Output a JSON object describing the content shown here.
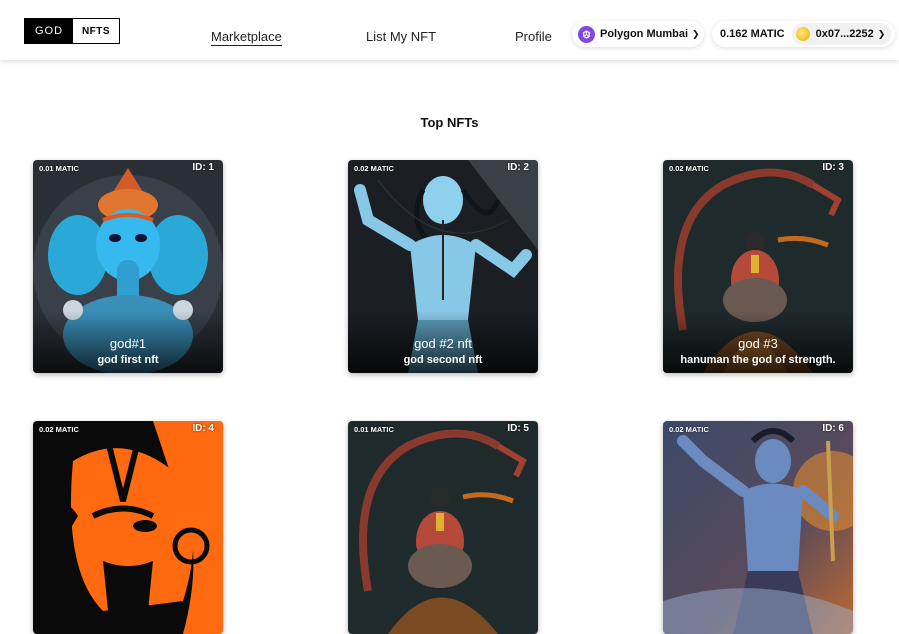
{
  "logo": {
    "left_text": "GOD",
    "right_text": "NFTS"
  },
  "nav": {
    "marketplace": "Marketplace",
    "list": "List My NFT",
    "profile": "Profile"
  },
  "network": {
    "label": "Polygon Mumbai",
    "icon": "polygon-icon",
    "color": "#8247e5"
  },
  "wallet": {
    "balance": "0.162 MATIC",
    "address": "0x07...2252",
    "icon": "coin-icon"
  },
  "main": {
    "title": "Top NFTs",
    "cards": [
      {
        "price": "0.01 MATIC",
        "id": "ID: 1",
        "name": "god#1",
        "desc": "god first nft",
        "art": "blue-ganesha-artwork"
      },
      {
        "price": "0.02 MATIC",
        "id": "ID: 2",
        "name": "god #2 nft",
        "desc": "god second nft",
        "art": "blue-shiva-artwork"
      },
      {
        "price": "0.02 MATIC",
        "id": "ID: 3",
        "name": "god #3",
        "desc": "hanuman the god of strength.",
        "art": "hanuman-artwork"
      },
      {
        "price": "0.02 MATIC",
        "id": "ID: 4",
        "name": "",
        "desc": "",
        "art": "orange-hanuman-artwork"
      },
      {
        "price": "0.01 MATIC",
        "id": "ID: 5",
        "name": "",
        "desc": "",
        "art": "hanuman-artwork"
      },
      {
        "price": "0.02 MATIC",
        "id": "ID: 6",
        "name": "",
        "desc": "",
        "art": "shiva-battle-artwork"
      }
    ]
  }
}
